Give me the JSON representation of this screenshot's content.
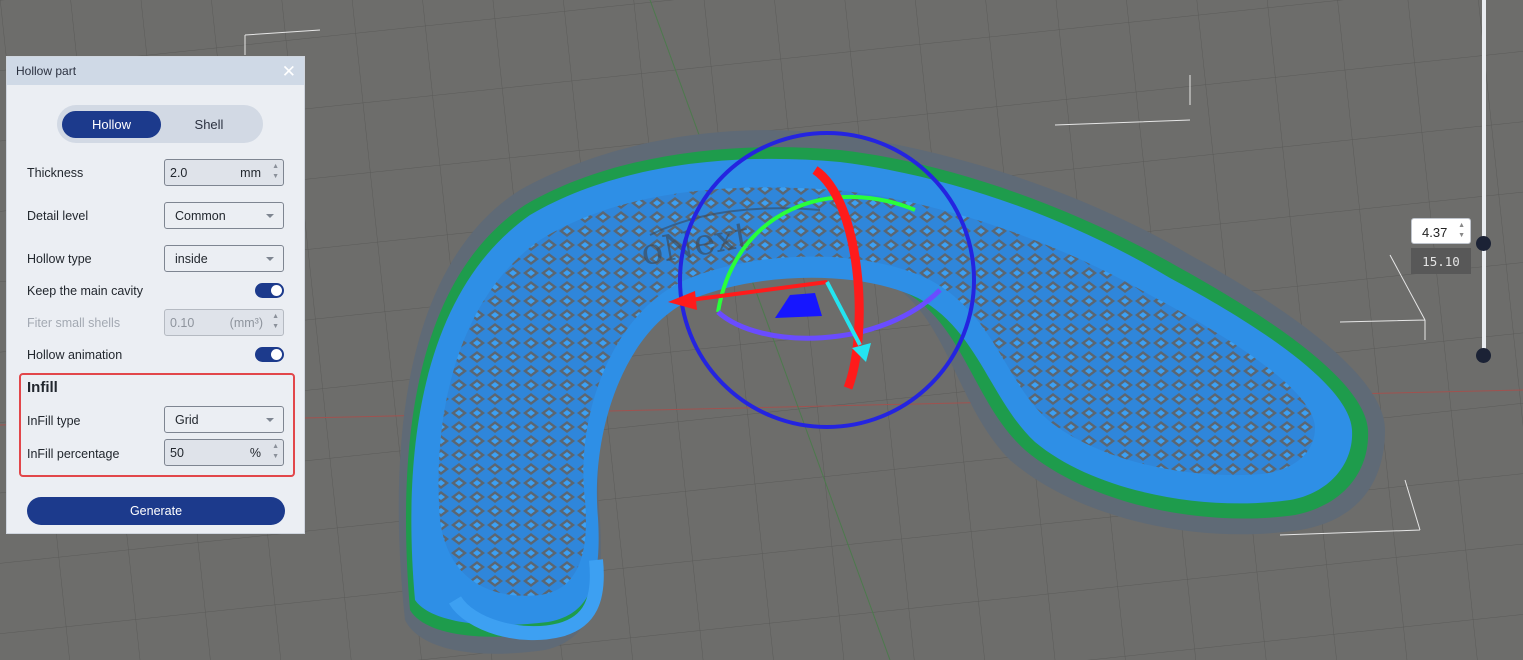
{
  "panel": {
    "title": "Hollow part",
    "close_icon": "close-icon",
    "mode_tabs": [
      {
        "label": "Hollow",
        "active": true
      },
      {
        "label": "Shell",
        "active": false
      }
    ],
    "thickness": {
      "label": "Thickness",
      "value": "2.0",
      "unit": "mm"
    },
    "detail_level": {
      "label": "Detail level",
      "value": "Common"
    },
    "hollow_type": {
      "label": "Hollow type",
      "value": "inside"
    },
    "keep_main_cavity": {
      "label": "Keep the main cavity",
      "on": true
    },
    "filter_small_shells": {
      "label": "Fiter small shells",
      "value": "0.10",
      "unit": "(mm³)",
      "disabled": true
    },
    "hollow_animation": {
      "label": "Hollow animation",
      "on": true
    },
    "infill": {
      "title": "Infill",
      "type": {
        "label": "InFill type",
        "value": "Grid"
      },
      "percentage": {
        "label": "InFill percentage",
        "value": "50",
        "unit": "%"
      }
    },
    "generate_label": "Generate"
  },
  "layer_slider": {
    "current": "4.37",
    "total": "15.10",
    "fraction": 0.29
  },
  "model_text": "oNext",
  "colors": {
    "accent": "#1c3a8c",
    "highlight_border": "#e2464a",
    "model_blue": "#2e8fe6",
    "model_green": "#1e9c4c",
    "model_grey": "#5f6a76",
    "axis_red": "#ff1b1b",
    "axis_green": "#29ff3a",
    "axis_blue": "#2424e0",
    "axis_cyan": "#24e4f0",
    "axis_purple": "#6a4cff"
  }
}
